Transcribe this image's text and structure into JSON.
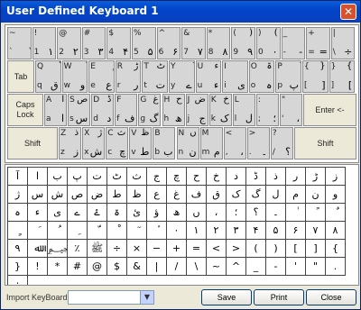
{
  "window": {
    "title": "User Defined Keyboard 1",
    "close_glyph": "✕"
  },
  "keyboard": {
    "row1": [
      {
        "lt": "~",
        "lb": "`",
        "rt": "",
        "rb": "ّ"
      },
      {
        "lt": "!",
        "lb": "1",
        "rt": "",
        "rb": "۱"
      },
      {
        "lt": "@",
        "lb": "2",
        "rt": "",
        "rb": "۲"
      },
      {
        "lt": "#",
        "lb": "3",
        "rt": "",
        "rb": "۳"
      },
      {
        "lt": "$",
        "lb": "4",
        "rt": "",
        "rb": "۴"
      },
      {
        "lt": "%",
        "lb": "5",
        "rt": "",
        "rb": "۵"
      },
      {
        "lt": "^",
        "lb": "6",
        "rt": "",
        "rb": "۶"
      },
      {
        "lt": "&",
        "lb": "7",
        "rt": "",
        "rb": "۷"
      },
      {
        "lt": "*",
        "lb": "8",
        "rt": "",
        "rb": "۸"
      },
      {
        "lt": "(",
        "lb": "9",
        "rt": ")",
        "rb": "۹"
      },
      {
        "lt": ")",
        "lb": "0",
        "rt": "(",
        "rb": "۰"
      },
      {
        "lt": "_",
        "lb": "-",
        "rt": "",
        "rb": "-"
      },
      {
        "lt": "+",
        "lb": "=",
        "rt": "",
        "rb": "="
      },
      {
        "lt": "|",
        "lb": "\\",
        "rt": "",
        "rb": "÷"
      }
    ],
    "row2": [
      {
        "lt": "Q",
        "lb": "q",
        "rt": "ْ",
        "rb": "ق"
      },
      {
        "lt": "W",
        "lb": "w",
        "rt": "ٌ",
        "rb": "و"
      },
      {
        "lt": "E",
        "lb": "e",
        "rt": "ٍ",
        "rb": "ع"
      },
      {
        "lt": "R",
        "lb": "r",
        "rt": "ڑ",
        "rb": "ر"
      },
      {
        "lt": "T",
        "lb": "t",
        "rt": "ٹ",
        "rb": "ت"
      },
      {
        "lt": "Y",
        "lb": "y",
        "rt": "َ",
        "rb": "ے"
      },
      {
        "lt": "U",
        "lb": "u",
        "rt": "ء",
        "rb": "ء"
      },
      {
        "lt": "I",
        "lb": "i",
        "rt": "ٰ",
        "rb": "ی"
      },
      {
        "lt": "O",
        "lb": "o",
        "rt": "ۃ",
        "rb": "ہ"
      },
      {
        "lt": "P",
        "lb": "p",
        "rt": "ُ",
        "rb": "پ"
      },
      {
        "lt": "{",
        "lb": "[",
        "rt": "}",
        "rb": "]"
      },
      {
        "lt": "}",
        "lb": "]",
        "rt": "{",
        "rb": "["
      }
    ],
    "row3": [
      {
        "lt": "A",
        "lb": "a",
        "rt": "آ",
        "rb": "ا"
      },
      {
        "lt": "S",
        "lb": "s",
        "rt": "ص",
        "rb": "س"
      },
      {
        "lt": "D",
        "lb": "d",
        "rt": "ڈ",
        "rb": "د"
      },
      {
        "lt": "F",
        "lb": "f",
        "rt": "",
        "rb": "ف"
      },
      {
        "lt": "G",
        "lb": "g",
        "rt": "غ",
        "rb": "گ"
      },
      {
        "lt": "H",
        "lb": "h",
        "rt": "ح",
        "rb": "ھ"
      },
      {
        "lt": "J",
        "lb": "j",
        "rt": "ض",
        "rb": "ج"
      },
      {
        "lt": "K",
        "lb": "k",
        "rt": "خ",
        "rb": "ک"
      },
      {
        "lt": "L",
        "lb": "l",
        "rt": "",
        "rb": "ل"
      },
      {
        "lt": ":",
        "lb": ";",
        "rt": "",
        "rb": "؛"
      },
      {
        "lt": "\"",
        "lb": "'",
        "rt": "",
        "rb": "،"
      }
    ],
    "row4": [
      {
        "lt": "Z",
        "lb": "z",
        "rt": "ذ",
        "rb": "ز"
      },
      {
        "lt": "X",
        "lb": "x",
        "rt": "ژ",
        "rb": "ش"
      },
      {
        "lt": "C",
        "lb": "c",
        "rt": "ث",
        "rb": "چ"
      },
      {
        "lt": "V",
        "lb": "v",
        "rt": "ظ",
        "rb": "ط"
      },
      {
        "lt": "B",
        "lb": "b",
        "rt": "",
        "rb": "ب"
      },
      {
        "lt": "N",
        "lb": "n",
        "rt": "ں",
        "rb": "ن"
      },
      {
        "lt": "M",
        "lb": "m",
        "rt": "",
        "rb": "م"
      },
      {
        "lt": "<",
        "lb": ",",
        "rt": "",
        "rb": "،"
      },
      {
        "lt": ">",
        "lb": ".",
        "rt": "",
        "rb": "۔"
      },
      {
        "lt": "?",
        "lb": "/",
        "rt": "",
        "rb": "؟"
      }
    ],
    "specials": {
      "tab": "Tab",
      "caps1": "Caps",
      "caps2": "Lock",
      "enter": "Enter <-",
      "shift_left": "Shift",
      "shift_right": "Shift"
    }
  },
  "char_grid": [
    "آ",
    "ا",
    "ب",
    "پ",
    "ت",
    "ٹ",
    "ث",
    "ج",
    "چ",
    "ح",
    "خ",
    "د",
    "ڈ",
    "ذ",
    "ر",
    "ڑ",
    "ز",
    "ژ",
    "س",
    "ش",
    "ص",
    "ض",
    "ط",
    "ظ",
    "ع",
    "غ",
    "ف",
    "ق",
    "ک",
    "گ",
    "ل",
    "م",
    "ن",
    "و",
    "ہ",
    "ء",
    "ی",
    "ے",
    "ۓ",
    "ۃ",
    "ئ",
    "ؤ",
    "ھ",
    "ں",
    "،",
    "؛",
    "؟",
    "۔",
    "ٰ",
    "ً",
    "ٌ",
    "ٍ",
    "َ",
    "ُ",
    "ِ",
    "ّ",
    "ْ",
    "ٓ",
    "ٔ",
    "۰",
    "۱",
    "۲",
    "۳",
    "۴",
    "۵",
    "۶",
    "۷",
    "۸",
    "۹",
    "ﷲ",
    "﷽",
    "٪",
    "ﷺ",
    "÷",
    "×",
    "−",
    "+",
    "=",
    "<",
    ">",
    "(",
    ")",
    "[",
    "]",
    "{",
    "}",
    "!",
    "*",
    "#",
    "@",
    "$",
    "&",
    "|",
    "/",
    "\\",
    "~",
    "^",
    "_",
    "-",
    "'",
    "\"",
    ".",
    ":"
  ],
  "bottom": {
    "import_label": "Import KeyBoard:",
    "import_value": "",
    "combo_arrow": "▼",
    "save": "Save",
    "print": "Print",
    "close": "Close"
  }
}
